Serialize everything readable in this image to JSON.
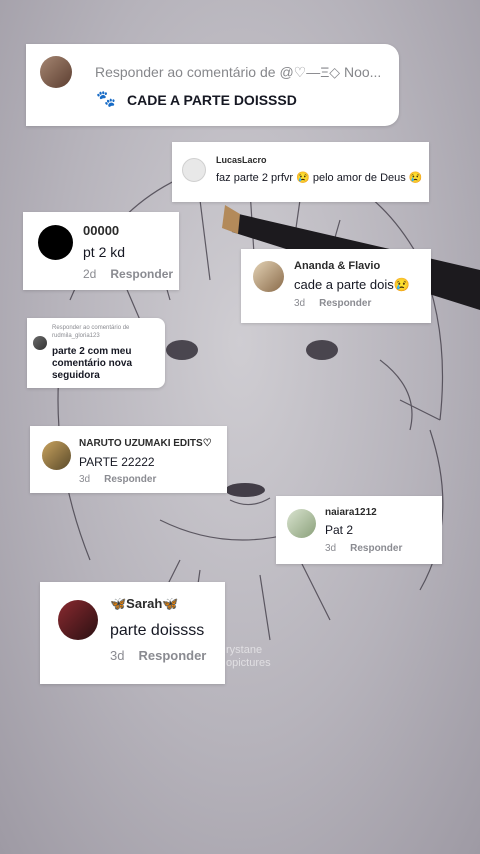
{
  "top_card": {
    "reply_to": "Responder ao comentário de @♡—Ξ◇ Noo...",
    "text": "CADE A PARTE DOISSSD"
  },
  "comments": [
    {
      "username": "LucasLacro",
      "text": "faz parte 2 prfvr 😢 pelo amor de Deus 😢"
    },
    {
      "username": "00000",
      "text": "pt 2 kd",
      "age": "2d",
      "reply": "Responder"
    },
    {
      "username": "Ananda & Flavio",
      "text": "cade a parte dois😢",
      "age": "3d",
      "reply": "Responder"
    },
    {
      "reply_to": "Responder ao comentário de rudmila_gloria123",
      "text_line1": "parte 2 com meu",
      "text_line2": "comentário nova",
      "text_line3": "seguidora"
    },
    {
      "username": "NARUTO UZUMAKI EDITS♡",
      "text": "PARTE 22222",
      "age": "3d",
      "reply": "Responder"
    },
    {
      "username": "naiara1212",
      "text": "Pat 2",
      "age": "3d",
      "reply": "Responder"
    },
    {
      "username": "🦋Sarah🦋",
      "text": "parte doissss",
      "age": "3d",
      "reply": "Responder"
    }
  ],
  "watermark": {
    "line1": "rystane",
    "line2": "opictures"
  }
}
